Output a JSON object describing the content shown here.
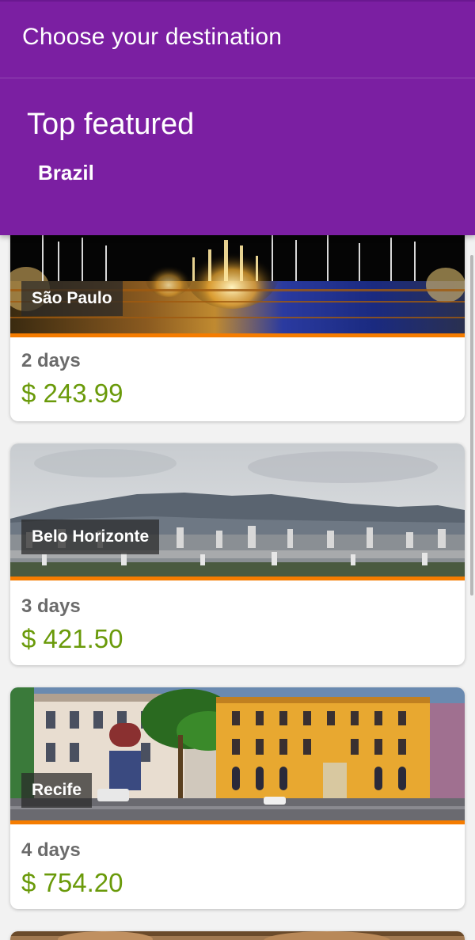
{
  "app_title": "Choose your destination",
  "section": {
    "title": "Top featured",
    "subtitle": "Brazil"
  },
  "colors": {
    "header": "#7b1fa2",
    "accent": "#f57c00",
    "price": "#6a9a0a"
  },
  "destinations": [
    {
      "city": "São Paulo",
      "duration": "2 days",
      "price": "$ 243.99",
      "image": "fountain-lights-night-photo"
    },
    {
      "city": "Belo Horizonte",
      "duration": "3 days",
      "price": "$ 421.50",
      "image": "city-skyline-mountains-photo"
    },
    {
      "city": "Recife",
      "duration": "4 days",
      "price": "$ 754.20",
      "image": "colonial-buildings-street-photo"
    }
  ]
}
